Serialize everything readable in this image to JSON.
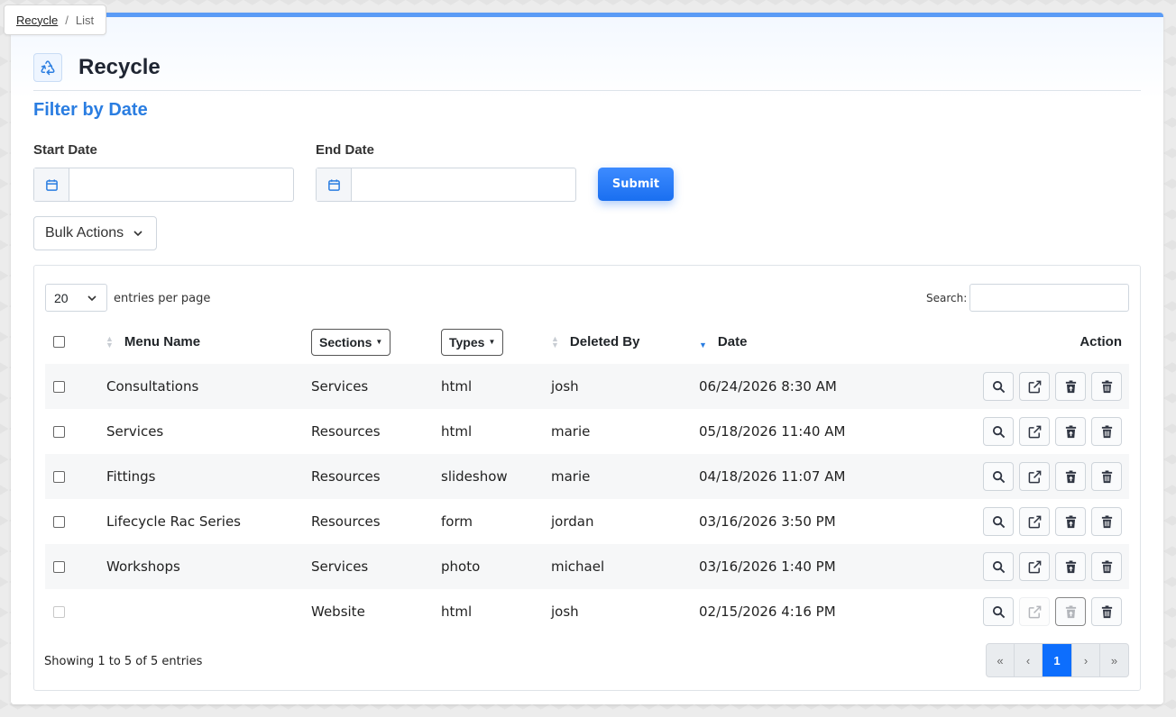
{
  "breadcrumb": {
    "root": "Recycle",
    "separator": "/",
    "current": "List"
  },
  "page": {
    "title": "Recycle",
    "icon": "recycle-icon"
  },
  "filter": {
    "title": "Filter by Date",
    "start_label": "Start Date",
    "end_label": "End Date",
    "start_value": "",
    "end_value": "",
    "submit_label": "Submit"
  },
  "bulk_actions": {
    "label": "Bulk Actions"
  },
  "table_controls": {
    "per_page_value": "20",
    "per_page_label": "entries per page",
    "search_label": "Search:",
    "search_value": ""
  },
  "columns": {
    "menu_name": "Menu Name",
    "sections": "Sections",
    "types": "Types",
    "deleted_by": "Deleted By",
    "date": "Date",
    "action": "Action"
  },
  "rows": [
    {
      "menu_name": "Consultations",
      "section": "Services",
      "type": "html",
      "deleted_by": "josh",
      "date": "06/24/2026 8:30 AM"
    },
    {
      "menu_name": "Services",
      "section": "Resources",
      "type": "html",
      "deleted_by": "marie",
      "date": "05/18/2026 11:40 AM"
    },
    {
      "menu_name": "Fittings",
      "section": "Resources",
      "type": "slideshow",
      "deleted_by": "marie",
      "date": "04/18/2026 11:07 AM"
    },
    {
      "menu_name": "Lifecycle Rac Series",
      "section": "Resources",
      "type": "form",
      "deleted_by": "jordan",
      "date": "03/16/2026 3:50 PM"
    },
    {
      "menu_name": "Workshops",
      "section": "Services",
      "type": "photo",
      "deleted_by": "michael",
      "date": "03/16/2026 1:40 PM"
    },
    {
      "menu_name": "",
      "section": "Website",
      "type": "html",
      "deleted_by": "josh",
      "date": "02/15/2026 4:16 PM"
    }
  ],
  "footer": {
    "showing": "Showing 1 to 5 of 5 entries",
    "pager": {
      "first": "«",
      "prev": "‹",
      "current": "1",
      "next": "›",
      "last": "»"
    }
  },
  "colors": {
    "accent": "#2a7de1",
    "primary_button": "#1a6ff0",
    "top_border": "#5a9bf6"
  }
}
